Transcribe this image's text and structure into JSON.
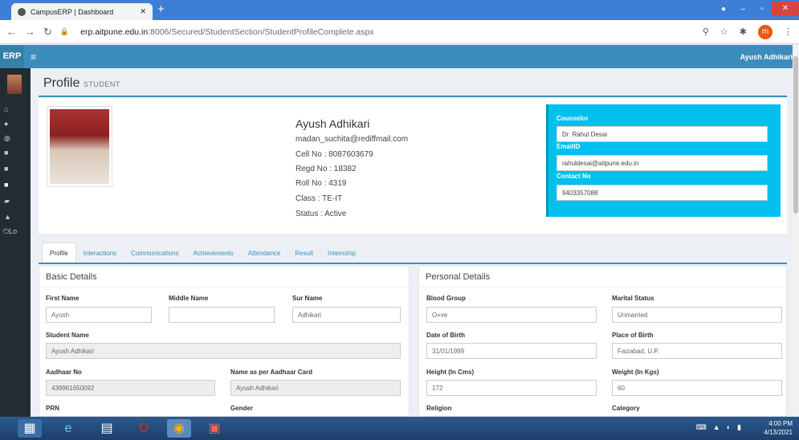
{
  "browser": {
    "tab_title": "CampusERP | Dashboard",
    "url_host": "erp.aitpune.edu.in",
    "url_path": ":8006/Secured/StudentSection/StudentProfileComplete.aspx",
    "avatar_letter": "m"
  },
  "app": {
    "logo": "ERP",
    "user": "Ayush Adhikari",
    "sidebar_footer": "Lo"
  },
  "page": {
    "title": "Profile",
    "subtitle": "STUDENT"
  },
  "profile": {
    "name": "Ayush Adhikari",
    "email": "madan_suchita@rediffmail.com",
    "cell": "Cell No : 8087603679",
    "regd": "Regd No : 18382",
    "roll": "Roll No : 4319",
    "class": "Class : TE-IT",
    "status": "Status : Active"
  },
  "counselor": {
    "label": "Counselor",
    "name": "Dr. Rahul Desai",
    "email_label": "EmailID",
    "email": "rahuldesai@aitpune.edu.in",
    "contact_label": "Contact No",
    "contact": "9403357088"
  },
  "tabs": [
    "Profile",
    "Interactions",
    "Communications",
    "Achievements",
    "Attendance",
    "Result",
    "Internship"
  ],
  "basic": {
    "title": "Basic Details",
    "first_name_label": "First Name",
    "first_name": "Ayush",
    "middle_name_label": "Middle Name",
    "middle_name": "",
    "sur_name_label": "Sur Name",
    "sur_name": "Adhikari",
    "student_name_label": "Student Name",
    "student_name": "Ayush Adhikari",
    "aadhaar_label": "Aadhaar No",
    "aadhaar": "439961650092",
    "aadhaar_name_label": "Name as per Aadhaar Card",
    "aadhaar_name": "Ayush Adhikari",
    "prn_label": "PRN",
    "gender_label": "Gender"
  },
  "personal": {
    "title": "Personal Details",
    "blood_label": "Blood Group",
    "blood": "O+ve",
    "marital_label": "Marital Status",
    "marital": "Unmarried",
    "dob_label": "Date of Birth",
    "dob": "31/01/1999",
    "pob_label": "Place of Birth",
    "pob": "Faizabad, U.P.",
    "height_label": "Height (In Cms)",
    "height": "172",
    "weight_label": "Weight (In Kgs)",
    "weight": "60",
    "religion_label": "Religion",
    "category_label": "Category"
  },
  "taskbar": {
    "time": "4:00 PM",
    "date": "4/13/2021"
  }
}
